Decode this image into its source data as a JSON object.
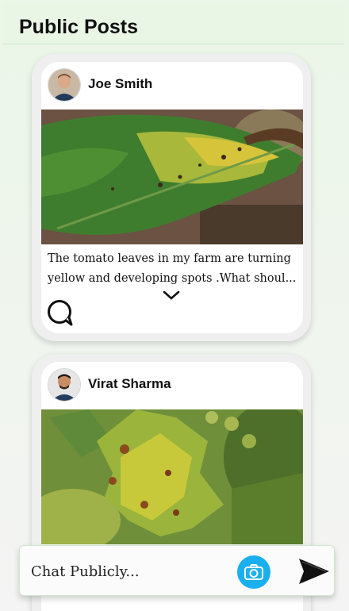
{
  "header": {
    "title": "Public Posts"
  },
  "posts": [
    {
      "author": "Joe Smith",
      "caption": "The tomato leaves in my farm are turning\nyellow and developing spots .What shoul...",
      "image_icon": "tomato-leaf-photo",
      "avatar_icon": "user-avatar-photo"
    },
    {
      "author": "Virat Sharma",
      "caption": "",
      "image_icon": "grape-leaf-photo",
      "avatar_icon": "user-avatar-photo"
    }
  ],
  "chat": {
    "placeholder": "Chat Publicly..."
  },
  "colors": {
    "accent": "#1ab0ef",
    "header_bg": "#e9f6e6"
  }
}
